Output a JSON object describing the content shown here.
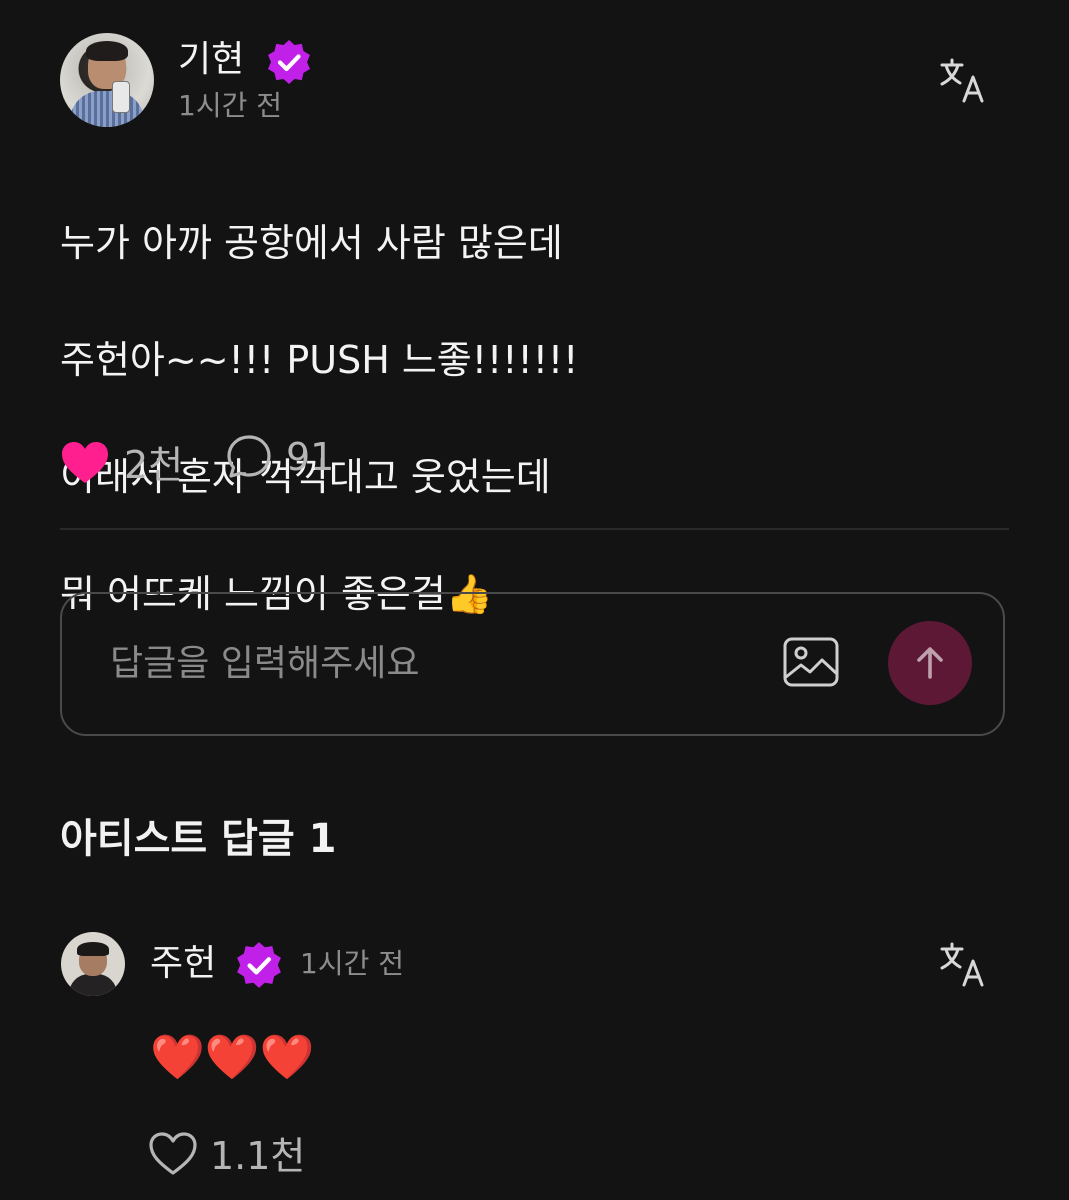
{
  "post": {
    "author": "기현",
    "time": "1시간 전",
    "body_lines": [
      "누가 아까 공항에서 사람 많은데",
      "주헌아~~!!! PUSH 느좋!!!!!!!",
      "이래서 혼자 꺽꺽대고 웃었는데",
      "뭐 어뜨케 느낌이 좋은걸👍"
    ],
    "likes": "2천",
    "comments": "91",
    "verified_icon": "verified-badge-icon",
    "translate_icon": "translate-icon"
  },
  "reply_input": {
    "placeholder": "답글을 입력해주세요",
    "image_icon": "image-icon",
    "send_icon": "arrow-up-icon"
  },
  "artist_replies": {
    "title": "아티스트 답글 1",
    "items": [
      {
        "author": "주헌",
        "time": "1시간 전",
        "content": "❤️❤️❤️",
        "likes": "1.1천"
      }
    ]
  },
  "colors": {
    "background": "#131313",
    "heart_filled": "#ff1f8e",
    "verified": "#c020e8",
    "send_button": "#5c1834",
    "muted_text": "#8d8d8d"
  }
}
